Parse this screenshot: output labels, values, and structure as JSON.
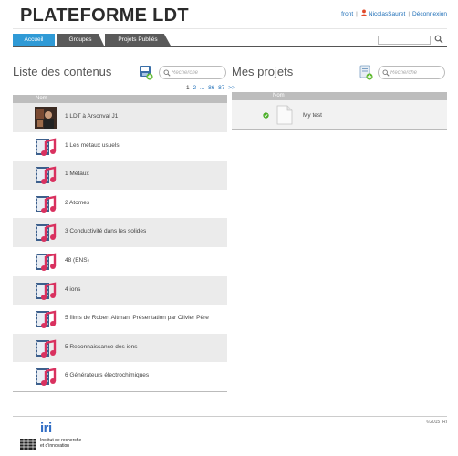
{
  "header": {
    "brand": "PLATEFORME LDT",
    "links": {
      "front": "front",
      "user": "NicolasSauret",
      "logout": "Déconnexion"
    }
  },
  "tabs": [
    {
      "label": "Accueil",
      "active": true
    },
    {
      "label": "Groupes",
      "active": false
    },
    {
      "label": "Projets Publiés",
      "active": false
    }
  ],
  "contents": {
    "title": "Liste des contenus",
    "search_placeholder": "Recherche",
    "pager": {
      "pages": [
        "1",
        "2",
        "...",
        "86",
        "87",
        ">>"
      ],
      "current": "1"
    },
    "column_header": "Nom",
    "items": [
      {
        "label": "1 LDT à Arsonval J1",
        "thumb": "photo-thumbnail"
      },
      {
        "label": "1 Les métaux usuels",
        "thumb": "media-film-icon"
      },
      {
        "label": "1 Métaux",
        "thumb": "media-film-icon"
      },
      {
        "label": "2 Atomes",
        "thumb": "media-film-icon"
      },
      {
        "label": "3 Conductivité dans les solides",
        "thumb": "media-film-icon"
      },
      {
        "label": "48 (ENS)",
        "thumb": "media-film-icon"
      },
      {
        "label": "4 ions",
        "thumb": "media-film-icon"
      },
      {
        "label": "5 films de Robert Altman. Présentation par Olivier Père",
        "thumb": "media-film-icon"
      },
      {
        "label": "5 Reconnaissance des ions",
        "thumb": "media-film-icon"
      },
      {
        "label": "6 Générateurs électrochimiques",
        "thumb": "media-film-icon"
      }
    ]
  },
  "projects": {
    "title": "Mes projets",
    "search_placeholder": "Recherche",
    "column_header": "Nom",
    "items": [
      {
        "label": "My test",
        "status": "check-icon"
      }
    ]
  },
  "footer": {
    "copyright": "©2015 IRI",
    "logo_name": "iri",
    "logo_text_line1": "Institut de recherche",
    "logo_text_line2": "et d'innovation"
  },
  "colors": {
    "accent": "#2f9ad6",
    "tab_inactive": "#5a5a5a",
    "row_alt": "#ebebeb",
    "header_row": "#bdbdbd",
    "media_pink": "#d9315f",
    "link": "#1f6fb8"
  }
}
